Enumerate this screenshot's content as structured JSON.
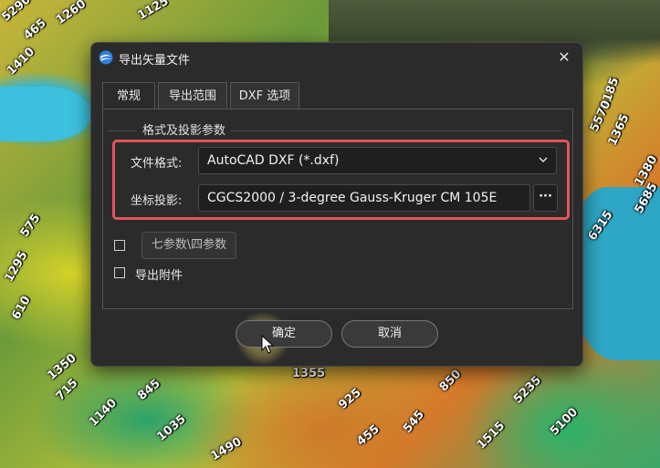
{
  "dialog": {
    "title": "导出矢量文件",
    "close_glyph": "✕",
    "icon": "app-logo-icon"
  },
  "tabs": [
    {
      "label": "常规",
      "active": true
    },
    {
      "label": "导出范围",
      "active": false
    },
    {
      "label": "DXF 选项",
      "active": false
    }
  ],
  "group": {
    "title": "格式及投影参数",
    "format_label": "文件格式:",
    "format_value": "AutoCAD DXF (*.dxf)",
    "projection_label": "坐标投影:",
    "projection_value": "CGCS2000 / 3-degree Gauss-Kruger CM 105E",
    "projection_button": "···"
  },
  "options": {
    "seven_params_checked": false,
    "seven_params_button": "七参数\\四参数",
    "export_attachments_checked": false,
    "export_attachments_label": "导出附件"
  },
  "buttons": {
    "ok": "确定",
    "cancel": "取消"
  },
  "colors": {
    "highlight_border": "#e4545a",
    "dialog_bg": "#2b2b2b"
  },
  "map_labels": [
    "5290",
    "465",
    "1260",
    "1125",
    "1410",
    "1185",
    "1365",
    "5685",
    "575",
    "1295",
    "6315",
    "1380",
    "5570",
    "610",
    "1355",
    "715",
    "1140",
    "845",
    "1350",
    "1035",
    "1490",
    "925",
    "455",
    "545",
    "5235",
    "5100",
    "850",
    "1515"
  ]
}
